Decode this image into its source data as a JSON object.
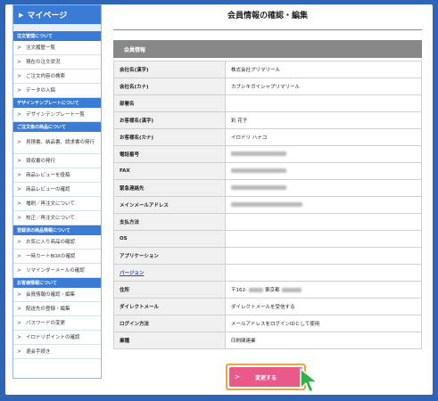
{
  "sidebar": {
    "title": "マイページ",
    "sections": [
      {
        "heading": "注文管理について",
        "items": [
          "注文履歴一覧",
          "現在の注文状況",
          "ご注文内容の検索",
          "データの入稿"
        ]
      },
      {
        "heading": "デザインテンプレートについて",
        "items": [
          "デザインテンプレート一覧"
        ]
      },
      {
        "heading": "ご注文後の商品について",
        "items": [
          "見積書、納品書、請求書の発行",
          "領収書の発行",
          "商品レビューを投稿",
          "商品レビューの確認",
          "増刷／再注文について",
          "校正／再注文について"
        ]
      },
      {
        "heading": "登録済の商品情報について",
        "items": [
          "お気に入り商品の確認",
          "一時カートBOXの確認",
          "リマインダーメールの確認"
        ]
      },
      {
        "heading": "お客様情報について",
        "items": [
          "会員情報の確認・編集",
          "配送先の登録・編集",
          "パスワードの変更",
          "イロドリポイントの確認",
          "退会手続き"
        ]
      }
    ]
  },
  "main": {
    "page_title": "会員情報の確認・編集",
    "section_title": "会員情報",
    "rows": [
      {
        "label": "会社名(漢字)",
        "value": "株式会社プリマリール"
      },
      {
        "label": "会社名(カナ)",
        "value": "カブシキガイシャプリマリール"
      },
      {
        "label": "部署名",
        "value": ""
      },
      {
        "label": "お客様名(漢字)",
        "value": "彩 花子"
      },
      {
        "label": "お客様名(カナ)",
        "value": "イロドリ ハナコ"
      },
      {
        "label": "電話番号",
        "value": ""
      },
      {
        "label": "FAX",
        "value": ""
      },
      {
        "label": "緊急連絡先",
        "value": ""
      },
      {
        "label": "メインメールアドレス",
        "value": ""
      },
      {
        "label": "支払方法",
        "value": ""
      },
      {
        "label": "OS",
        "value": ""
      },
      {
        "label": "アプリケーション",
        "value": ""
      },
      {
        "label": "バージョン",
        "value": ""
      },
      {
        "label": "住所",
        "value": "〒162-",
        "value_suffix": "東京都"
      },
      {
        "label": "ダイレクトメール",
        "value": "ダイレクトメールを受信する"
      },
      {
        "label": "ログイン方法",
        "value": "メールアドレスをログインIDとして使用"
      },
      {
        "label": "業種",
        "value": "印刷関連業"
      }
    ],
    "submit_label": "変更する"
  },
  "colors": {
    "accent": "#3a7bd5",
    "button": "#e95a8a",
    "button_border": "#f2a23a",
    "background": "#2d64b3"
  }
}
